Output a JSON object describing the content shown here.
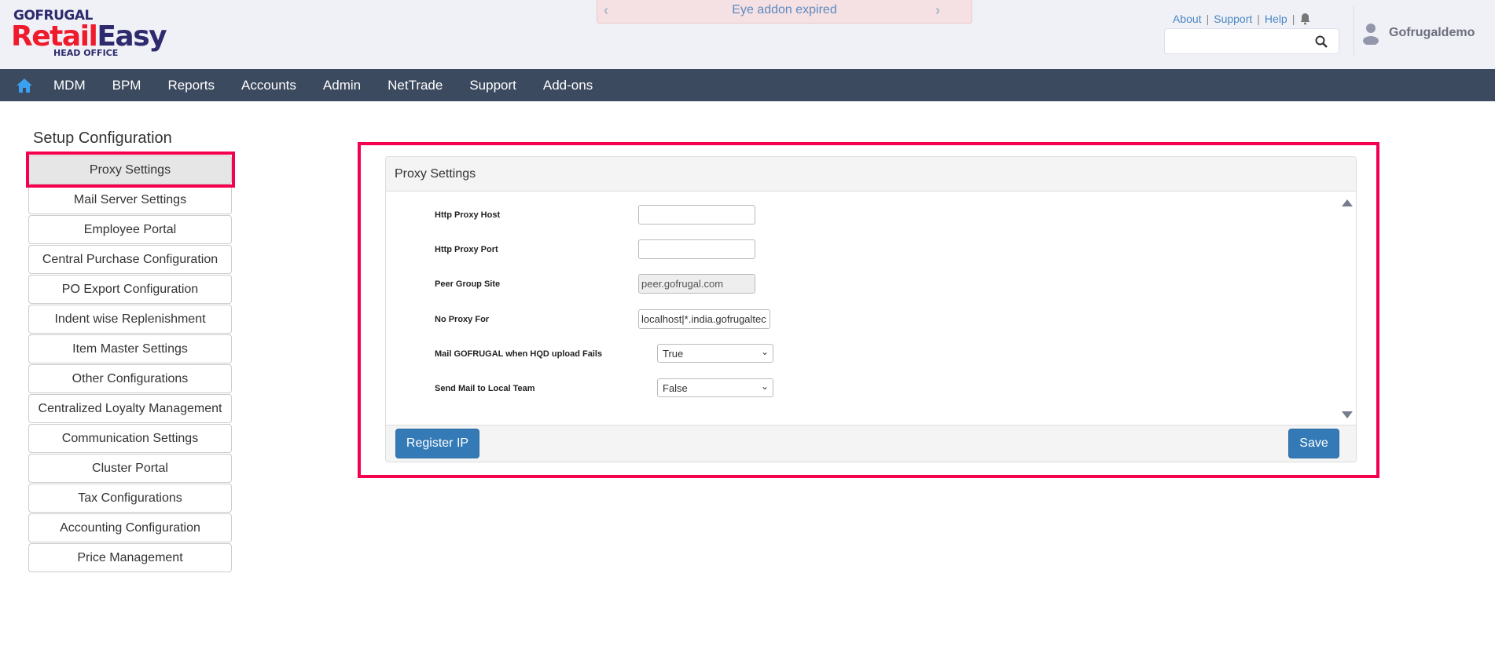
{
  "logo": {
    "brand": "GOFRUGAL",
    "product_red": "Retail",
    "product_blue": "Easy",
    "subtitle": "HEAD OFFICE"
  },
  "banner": {
    "text": "Eye addon expired"
  },
  "toplinks": {
    "about": "About",
    "support": "Support",
    "help": "Help"
  },
  "search": {
    "value": "",
    "placeholder": ""
  },
  "user": {
    "name": "Gofrugaldemo"
  },
  "nav": [
    "MDM",
    "BPM",
    "Reports",
    "Accounts",
    "Admin",
    "NetTrade",
    "Support",
    "Add-ons"
  ],
  "sidebar": {
    "title": "Setup Configuration",
    "items": [
      "Proxy Settings",
      "Mail Server Settings",
      "Employee Portal",
      "Central Purchase Configuration",
      "PO Export Configuration",
      "Indent wise Replenishment",
      "Item Master Settings",
      "Other Configurations",
      "Centralized Loyalty Management",
      "Communication Settings",
      "Cluster Portal",
      "Tax Configurations",
      "Accounting Configuration",
      "Price Management"
    ]
  },
  "panel": {
    "title": "Proxy Settings",
    "fields": {
      "host_label": "Http Proxy Host",
      "host_value": "",
      "port_label": "Http Proxy Port",
      "port_value": "",
      "peer_label": "Peer Group Site",
      "peer_value": "peer.gofrugal.com",
      "noproxy_label": "No Proxy For",
      "noproxy_value": "localhost|*.india.gofrugaltec",
      "mail_label": "Mail GOFRUGAL when HQD upload Fails",
      "mail_value": "True",
      "local_label": "Send Mail to Local Team",
      "local_value": "False"
    },
    "register_label": "Register IP",
    "save_label": "Save"
  },
  "colors": {
    "accent": "#337ab7",
    "nav": "#3c4a5f",
    "highlight": "#f5004f"
  }
}
